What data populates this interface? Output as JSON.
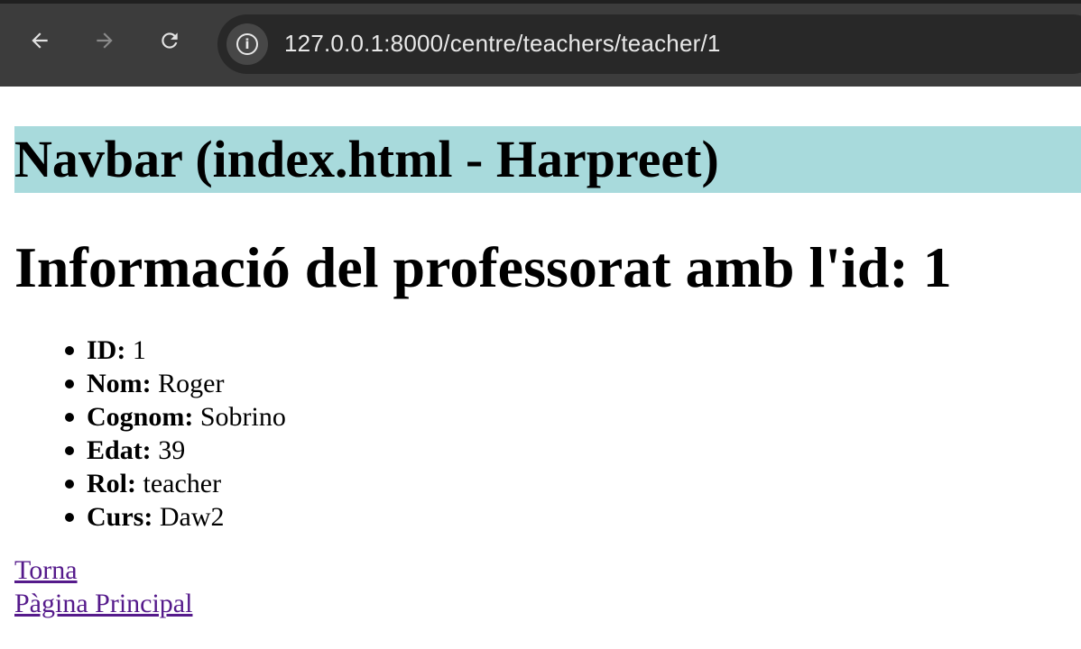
{
  "browser": {
    "back_icon": "arrow-left-icon",
    "forward_icon": "arrow-right-icon",
    "reload_icon": "reload-icon",
    "site_info_icon": "info-icon",
    "url": "127.0.0.1:8000/centre/teachers/teacher/1"
  },
  "page": {
    "navbar_text": "Navbar (index.html - Harpreet)",
    "title": "Informació del professorat amb l'id: 1",
    "fields": [
      {
        "label": "ID:",
        "value": "1"
      },
      {
        "label": "Nom:",
        "value": "Roger"
      },
      {
        "label": "Cognom:",
        "value": "Sobrino"
      },
      {
        "label": "Edat:",
        "value": "39"
      },
      {
        "label": "Rol:",
        "value": "teacher"
      },
      {
        "label": "Curs:",
        "value": "Daw2"
      }
    ],
    "links": {
      "back": "Torna",
      "home": "Pàgina Principal"
    }
  },
  "colors": {
    "navbar_bg": "#a8dadc",
    "visited_link": "#551a8b",
    "chrome_bg": "#3c3c3c"
  }
}
